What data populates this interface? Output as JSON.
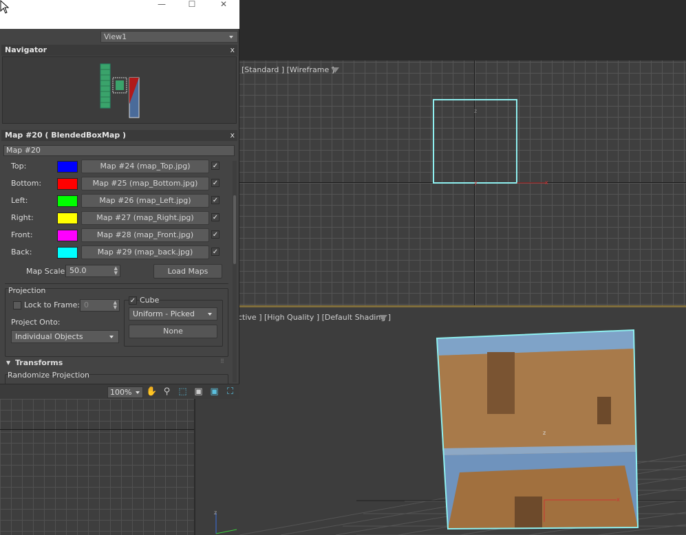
{
  "view_select": {
    "value": "View1"
  },
  "navigator": {
    "title": "Navigator",
    "close": "x"
  },
  "material": {
    "title": "Map #20  ( BlendedBoxMap )",
    "close": "x",
    "name_value": "Map #20",
    "rows": [
      {
        "label": "Top:",
        "color": "#0000ff",
        "map": "Map #24 (map_Top.jpg)",
        "checked": true
      },
      {
        "label": "Bottom:",
        "color": "#ff0000",
        "map": "Map #25 (map_Bottom.jpg)",
        "checked": true
      },
      {
        "label": "Left:",
        "color": "#00ff00",
        "map": "Map #26 (map_Left.jpg)",
        "checked": true
      },
      {
        "label": "Right:",
        "color": "#ffff00",
        "map": "Map #27 (map_Right.jpg)",
        "checked": true
      },
      {
        "label": "Front:",
        "color": "#ff00ff",
        "map": "Map #28 (map_Front.jpg)",
        "checked": true
      },
      {
        "label": "Back:",
        "color": "#00ffff",
        "map": "Map #29 (map_back.jpg)",
        "checked": true
      }
    ],
    "map_scale_label": "Map Scale:",
    "map_scale_value": "50.0",
    "load_maps_label": "Load Maps",
    "projection": {
      "title": "Projection",
      "lock_to_frame_label": "Lock to Frame:",
      "lock_to_frame_value": "0",
      "project_onto_label": "Project Onto:",
      "project_onto_value": "Individual Objects",
      "cube_label": "Cube",
      "cube_mode_value": "Uniform - Picked",
      "none_label": "None"
    },
    "transforms_title": "Transforms",
    "randomize_label": "Randomize Projection"
  },
  "status": {
    "zoom_value": "100%"
  },
  "viewports": {
    "front_label": "[Standard ] [Wireframe ]",
    "persp_label": "ctive ] [High Quality ] [Default Shading ]"
  }
}
